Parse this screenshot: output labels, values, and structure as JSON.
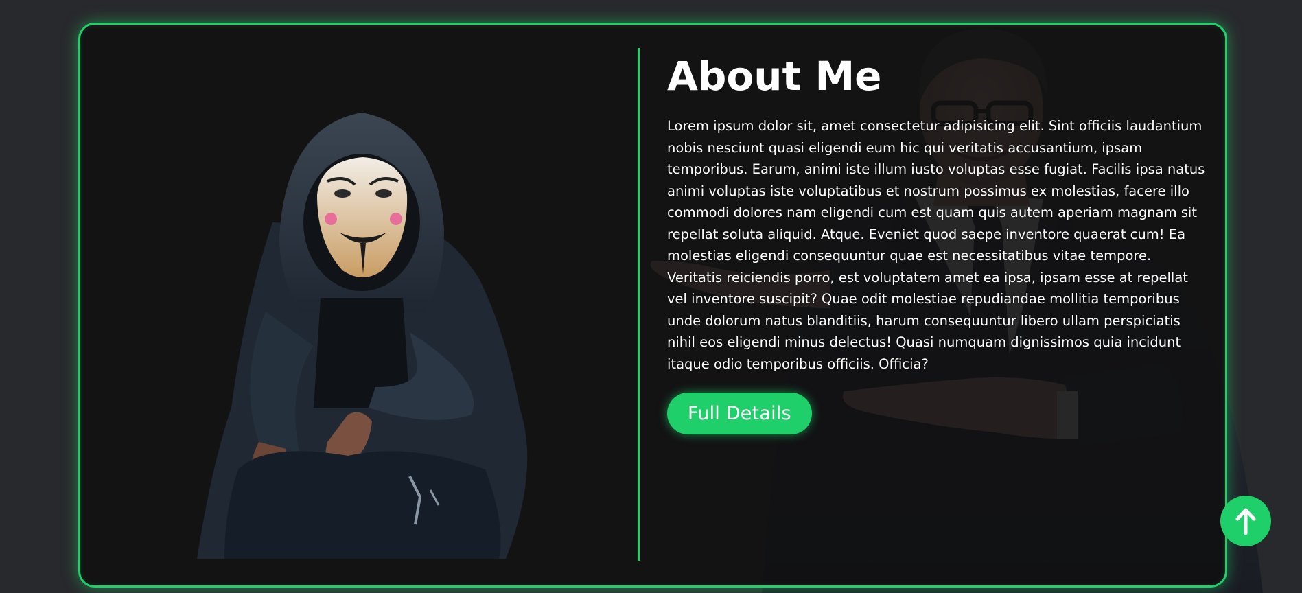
{
  "about": {
    "title": "About Me",
    "body": "Lorem ipsum dolor sit, amet consectetur adipisicing elit. Sint officiis laudantium nobis nesciunt quasi eligendi eum hic qui veritatis accusantium, ipsam temporibus. Earum, animi iste illum iusto voluptas esse fugiat. Facilis ipsa natus animi voluptas iste voluptatibus et nostrum possimus ex molestias, facere illo commodi dolores nam eligendi cum est quam quis autem aperiam magnam sit repellat soluta aliquid. Atque. Eveniet quod saepe inventore quaerat cum! Ea molestias eligendi consequuntur quae est necessitatibus vitae tempore. Veritatis reiciendis porro, est voluptatem amet ea ipsa, ipsam esse at repellat vel inventore suscipit? Quae odit molestiae repudiandae mollitia temporibus unde dolorum natus blanditiis, harum consequuntur libero ullam perspiciatis nihil eos eligendi minus delectus! Quasi numquam dignissimos quia incidunt itaque odio temporibus officiis. Officia?",
    "button_label": "Full Details"
  },
  "icons": {
    "scroll_top": "arrow-up-icon"
  },
  "colors": {
    "accent": "#1fd06a",
    "background": "#28292c",
    "card": "#111112",
    "text": "#ffffff"
  }
}
